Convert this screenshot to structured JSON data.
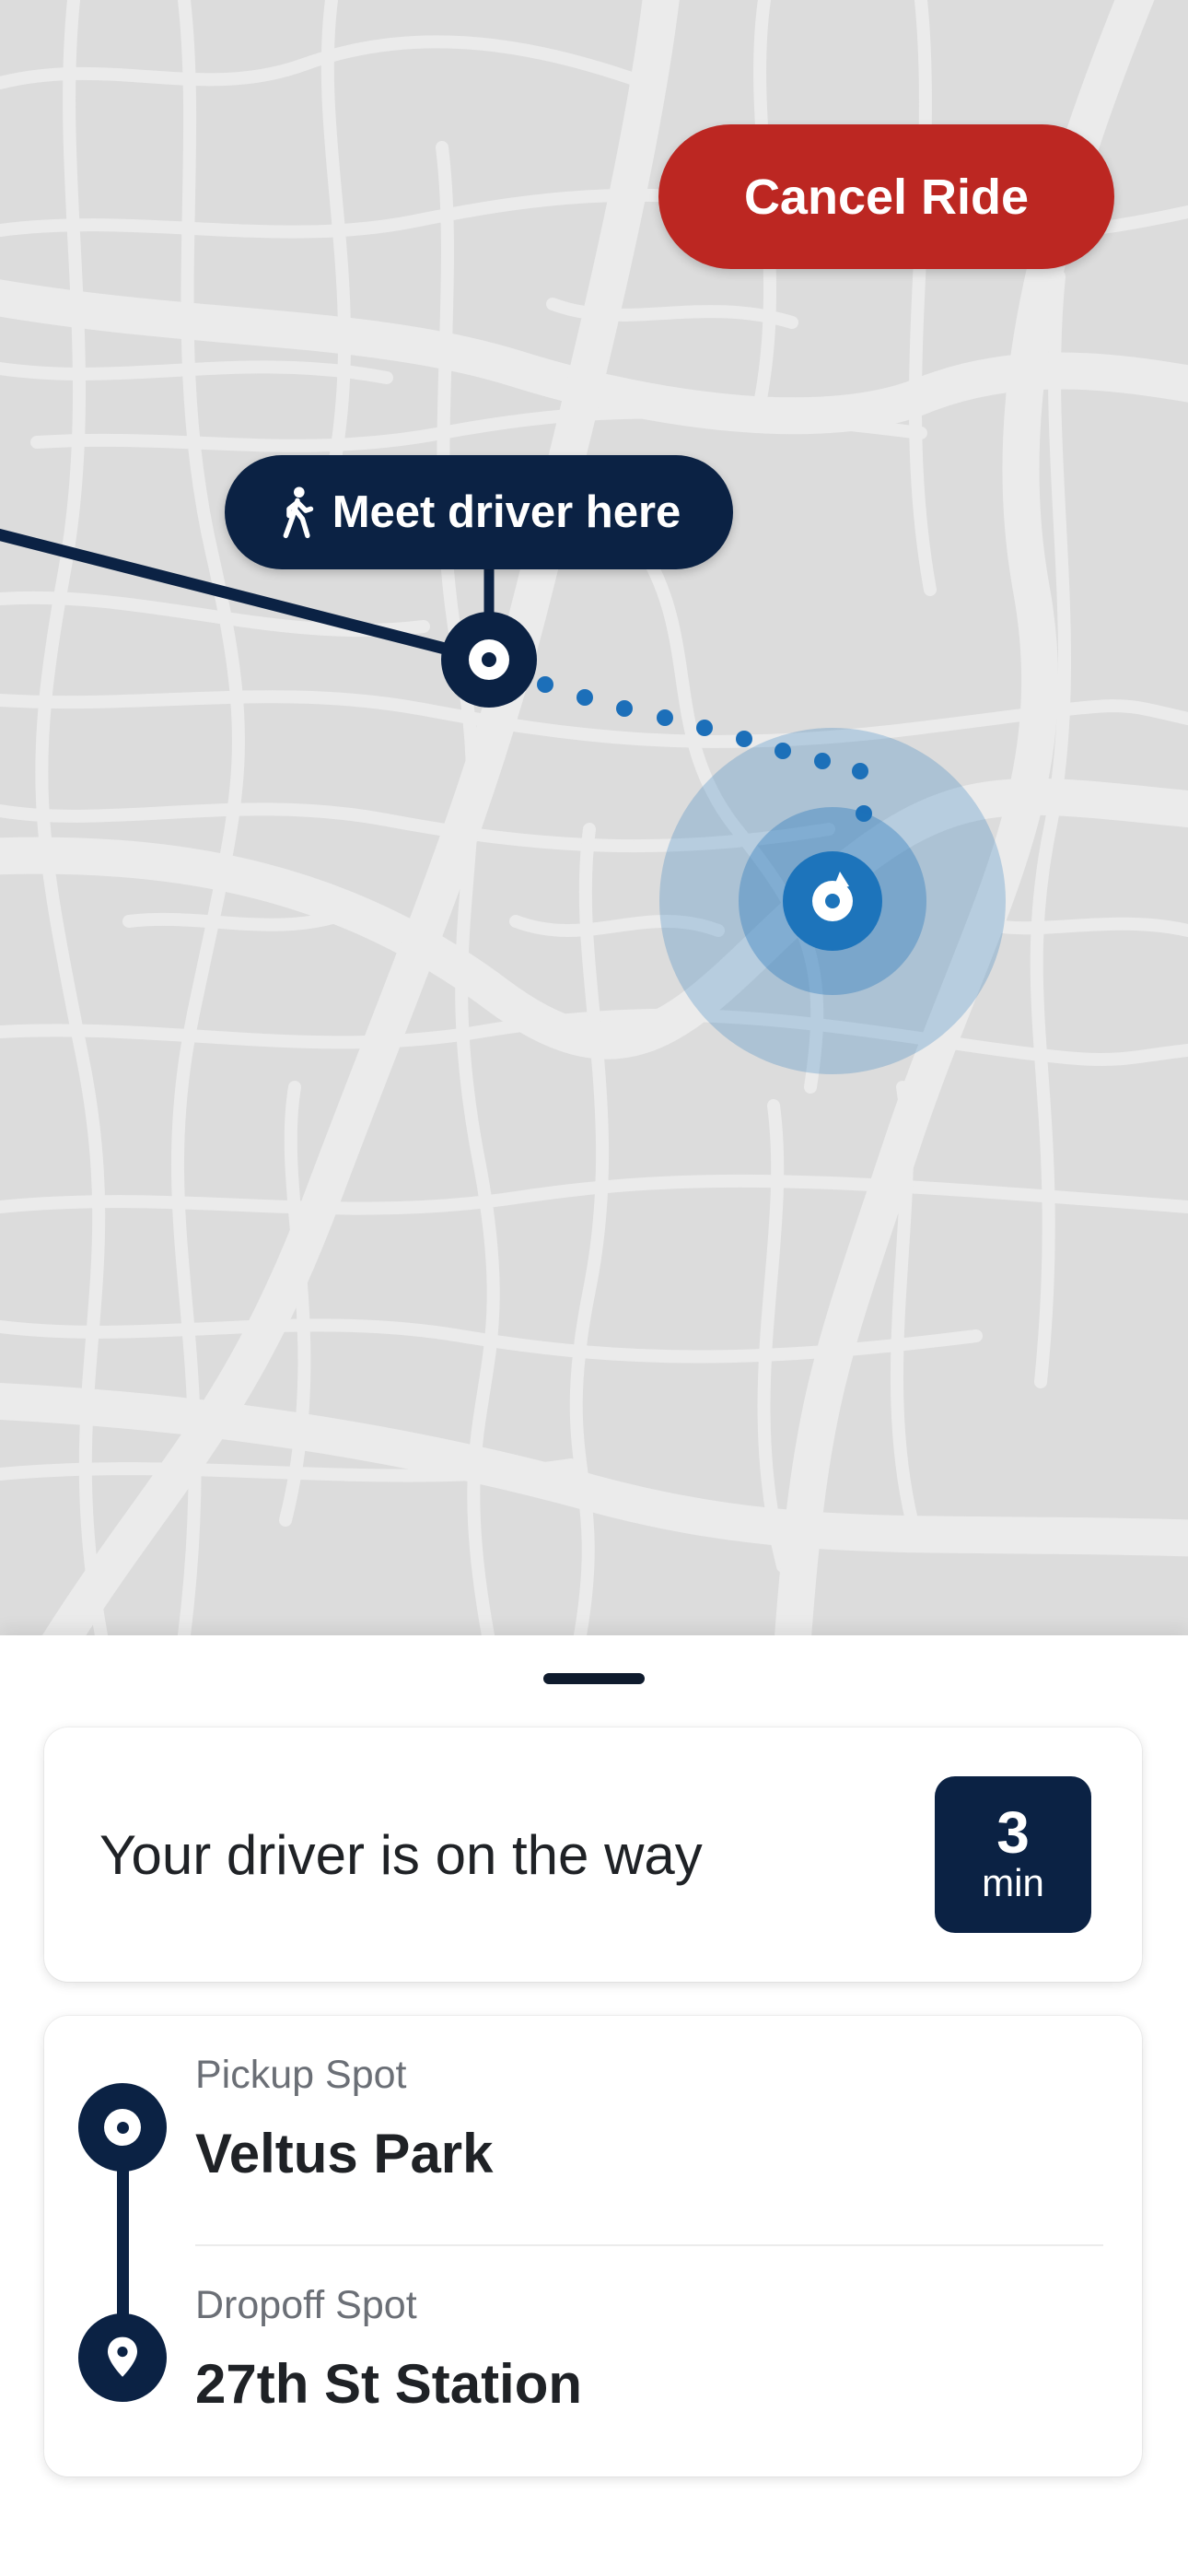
{
  "map": {
    "cancel_button_label": "Cancel Ride",
    "meeting_tooltip_label": "Meet driver here",
    "colors": {
      "route": "#0b2244",
      "driver_route": "#1c6fb9",
      "driver_marker": "#1d74bb",
      "cancel": "#bc2722"
    }
  },
  "sheet": {
    "status_text": "Your driver is on the way",
    "eta_value": "3",
    "eta_unit": "min",
    "pickup": {
      "label": "Pickup Spot",
      "name": "Veltus Park"
    },
    "dropoff": {
      "label": "Dropoff Spot",
      "name": "27th St Station"
    }
  }
}
